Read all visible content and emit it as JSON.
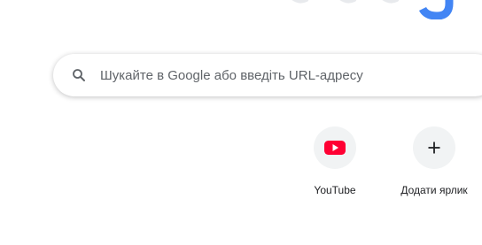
{
  "search": {
    "placeholder": "Шукайте в Google або введіть URL-адресу"
  },
  "shortcuts": [
    {
      "label": "YouTube",
      "icon": "youtube-icon"
    },
    {
      "label": "Додати ярлик",
      "icon": "plus-icon"
    }
  ],
  "colors": {
    "youtube_red": "#ff0033",
    "google_blue": "#4285f4",
    "tile_bg": "#f1f3f4",
    "placeholder_text": "#5f6368"
  }
}
